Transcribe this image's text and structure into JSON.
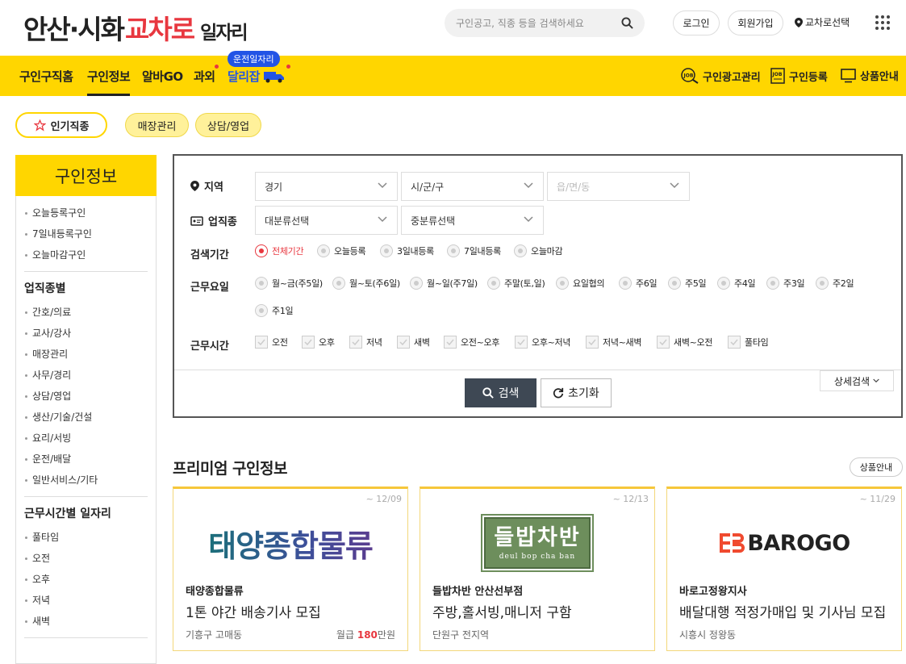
{
  "header": {
    "logo_part1": "안산·시화",
    "logo_part2": "교차로",
    "logo_part3": "일자리",
    "search_placeholder": "구인공고, 직종 등을 검색하세요",
    "login": "로그인",
    "signup": "회원가입",
    "region_select": "교차로선택"
  },
  "nav": {
    "items": [
      "구인구직홈",
      "구인정보",
      "알바GO",
      "과외",
      "달리잡"
    ],
    "active": "구인정보",
    "bubble": "운전일자리",
    "right_items": [
      "구인광고관리",
      "구인등록",
      "상품안내"
    ]
  },
  "chips": {
    "popular": "인기직종",
    "tags": [
      "매장관리",
      "상담/영업"
    ]
  },
  "sidebar": {
    "title": "구인정보",
    "group1": [
      "오늘등록구인",
      "7일내등록구인",
      "오늘마감구인"
    ],
    "group2_title": "업직종별",
    "group2": [
      "간호/의료",
      "교사/강사",
      "매장관리",
      "사무/경리",
      "상담/영업",
      "생산/기술/건설",
      "요리/서빙",
      "운전/배달",
      "일반서비스/기타"
    ],
    "group3_title": "근무시간별 일자리",
    "group3": [
      "풀타임",
      "오전",
      "오후",
      "저녁",
      "새벽"
    ]
  },
  "search_panel": {
    "region_label": "지역",
    "region_values": [
      "경기",
      "시/군/구",
      "읍/면/동"
    ],
    "job_label": "업직종",
    "job_values": [
      "대분류선택",
      "중분류선택"
    ],
    "period_label": "검색기간",
    "period_options": [
      "전체기간",
      "오늘등록",
      "3일내등록",
      "7일내등록",
      "오늘마감"
    ],
    "period_selected": "전체기간",
    "days_label": "근무요일",
    "days_options": [
      "월~금(주5일)",
      "월~토(주6일)",
      "월~일(주7일)",
      "주말(토,일)",
      "요일협의",
      "주6일",
      "주5일",
      "주4일",
      "주3일",
      "주2일",
      "주1일"
    ],
    "time_label": "근무시간",
    "time_options": [
      "오전",
      "오후",
      "저녁",
      "새벽",
      "오전~오후",
      "오후~저녁",
      "저녁~새벽",
      "새벽~오전",
      "풀타임"
    ],
    "search_button": "검색",
    "reset_button": "초기화",
    "detail_button": "상세검색"
  },
  "premium": {
    "title": "프리미엄 구인정보",
    "guide_button": "상품안내",
    "cards": [
      {
        "date": "~ 12/09",
        "logo_text": "태양종합물류",
        "company": "태양종합물류",
        "job": "1톤 야간 배송기사 모집",
        "area": "기흥구 고매동",
        "pay_label": "월급",
        "pay_value": "180",
        "pay_unit": "만원"
      },
      {
        "date": "~ 12/13",
        "logo_text": "들밥차반",
        "logo_sub": "deul bop cha ban",
        "company": "들밥차반 안산선부점",
        "job": "주방,홀서빙,매니저 구함",
        "area": "단원구 전지역"
      },
      {
        "date": "~ 11/29",
        "logo_text": "BAROGO",
        "company": "바로고정왕지사",
        "job": "배달대행 적정가매입 및 기사님 모집",
        "area": "시흥시 정왕동"
      }
    ]
  },
  "colors": {
    "brand_yellow": "#ffd600",
    "accent_red": "#e8373f",
    "bubble_blue": "#2254e6"
  }
}
